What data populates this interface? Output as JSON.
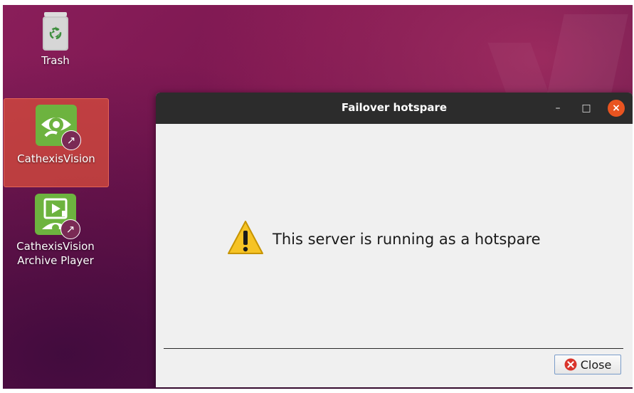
{
  "desktop": {
    "icons": [
      {
        "label": "Trash",
        "icon": "trash-icon"
      },
      {
        "label": "CathexisVision",
        "icon": "eye-app-icon",
        "selected": true,
        "shortcut_badge": "↗"
      },
      {
        "label": "CathexisVision Archive Player",
        "label_lines": [
          "CathexisVision",
          "Archive Player"
        ],
        "icon": "archive-player-icon",
        "shortcut_badge": "↗"
      }
    ]
  },
  "dialog": {
    "title": "Failover hotspare",
    "window_controls": {
      "minimize": "–",
      "maximize": "□",
      "close": "×"
    },
    "message": "This server is running as a hotspare",
    "message_icon": "warning-icon",
    "close_button_label": "Close",
    "close_button_icon": "close-circle-icon"
  },
  "colors": {
    "titlebar": "#2c2c2c",
    "close_accent": "#e95420",
    "dialog_bg": "#f0f0f0",
    "selection": "#d84c3c",
    "app_green": "#6db33f"
  }
}
